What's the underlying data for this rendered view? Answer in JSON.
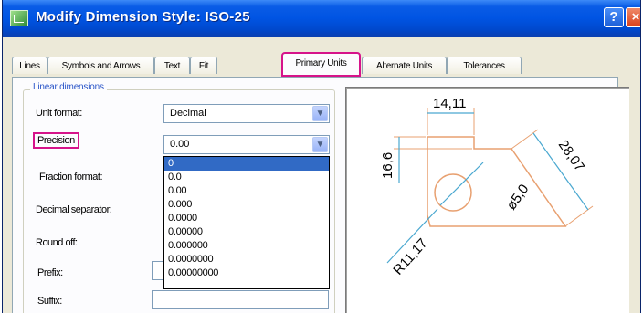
{
  "window": {
    "title": "Modify Dimension Style: ISO-25",
    "help_glyph": "?",
    "close_glyph": "×"
  },
  "tabs": [
    {
      "label": "Lines"
    },
    {
      "label": "Symbols and Arrows"
    },
    {
      "label": "Text"
    },
    {
      "label": "Fit"
    },
    {
      "label": "Primary Units",
      "active": true
    },
    {
      "label": "Alternate Units"
    },
    {
      "label": "Tolerances"
    }
  ],
  "linear": {
    "group_title": "Linear dimensions",
    "unit_format": {
      "label": "Unit format:",
      "value": "Decimal"
    },
    "precision": {
      "label": "Precision",
      "value": "0.00",
      "options": [
        "0",
        "0.0",
        "0.00",
        "0.000",
        "0.0000",
        "0.00000",
        "0.000000",
        "0.0000000",
        "0.00000000"
      ],
      "highlighted_option": "0"
    },
    "fraction_format": {
      "label": "Fraction format:"
    },
    "decimal_separator": {
      "label": "Decimal separator:"
    },
    "round_off": {
      "label": "Round off:"
    },
    "prefix": {
      "label": "Prefix:"
    },
    "suffix": {
      "label": "Suffix:"
    }
  },
  "preview": {
    "dim_top": "14,11",
    "dim_left": "16,6",
    "dim_right": "28,07",
    "dim_dia": "ø5,0",
    "dim_radius": "R11,17",
    "colors": {
      "outline": "#e8a070",
      "dimension": "#4aa8d0",
      "text": "#000000"
    }
  },
  "colors": {
    "highlight": "#d6138a",
    "titlebar": "#0054e3",
    "selection": "#316ac5"
  }
}
